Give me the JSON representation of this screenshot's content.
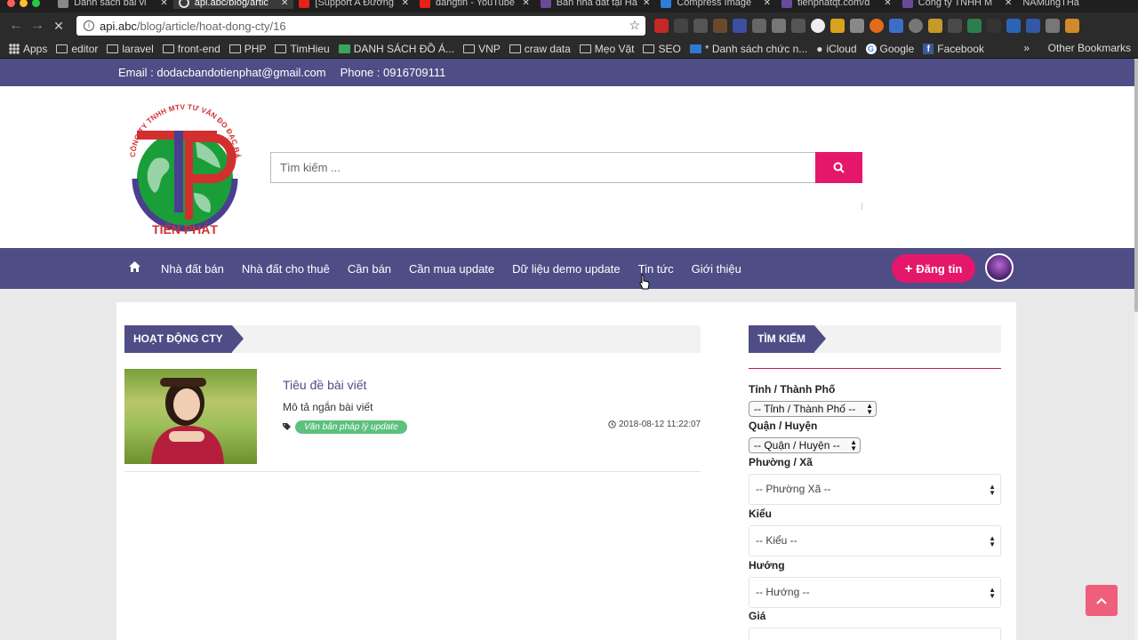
{
  "browser": {
    "tabs": [
      {
        "title": "Danh sách bài vi",
        "color": "#888"
      },
      {
        "title": "api.abc/blog/artic",
        "color": "#888"
      },
      {
        "title": "[Support A Đường",
        "color": "#e62117"
      },
      {
        "title": "dangtin - YouTube",
        "color": "#e62117"
      },
      {
        "title": "Bán nhà đất tại Hà",
        "color": "#6a4b9b"
      },
      {
        "title": "Compress Image",
        "color": "#2e7dd7"
      },
      {
        "title": "tienphatqt.com/d",
        "color": "#6a4b9b"
      },
      {
        "title": "Công ty TNHH M",
        "color": "#6a4b9b"
      },
      {
        "title": "NAMungTHa",
        "color": "#888"
      }
    ],
    "url_host": "api.abc",
    "url_path": "/blog/article/hoat-dong-cty/16",
    "bookmarks": [
      "Apps",
      "editor",
      "laravel",
      "front-end",
      "PHP",
      "TimHieu",
      "DANH SÁCH ĐỒ Á...",
      "VNP",
      "craw data",
      "Mẹo Vặt",
      "SEO",
      "* Danh sách chức n...",
      "iCloud",
      "Google",
      "Facebook"
    ],
    "bookmarks_more": "»",
    "other_bookmarks": "Other Bookmarks"
  },
  "topbar": {
    "email": "Email : dodacbandotienphat@gmail.com",
    "phone": "Phone : 0916709111"
  },
  "logo": {
    "arc_text": "CÔNG TY TNHH MTV TƯ VẤN ĐO ĐẠC BẢN ĐỒ",
    "name": "TIẾN PHÁT"
  },
  "search": {
    "placeholder": "Tìm kiếm ..."
  },
  "nav": {
    "items": [
      "Nhà đất bán",
      "Nhà đất cho thuê",
      "Cần bán",
      "Cần mua update",
      "Dữ liệu demo update",
      "Tin tức",
      "Giới thiệu"
    ],
    "post_button": "Đăng tin"
  },
  "content": {
    "section_title": "HOẠT ĐỘNG CTY",
    "article": {
      "title": "Tiêu đề bài viết",
      "description": "Mô tả ngắn bài viết",
      "tag": "Văn bản pháp lý update",
      "datetime": "2018-08-12 11:22:07"
    }
  },
  "sidebar": {
    "title": "TÌM KIẾM",
    "province_label": "Tỉnh / Thành Phố",
    "province_value": "-- Tỉnh / Thành Phố --",
    "district_label": "Quận / Huyện",
    "district_value": "-- Quận / Huyện --",
    "ward_label": "Phường / Xã",
    "ward_value": "-- Phường Xã --",
    "type_label": "Kiểu",
    "type_value": "-- Kiểu --",
    "direction_label": "Hướng",
    "direction_value": "-- Hướng --",
    "price_label": "Giá"
  },
  "colors": {
    "primary": "#4e4d86",
    "accent": "#e5176b",
    "tag": "#5cc17d"
  }
}
